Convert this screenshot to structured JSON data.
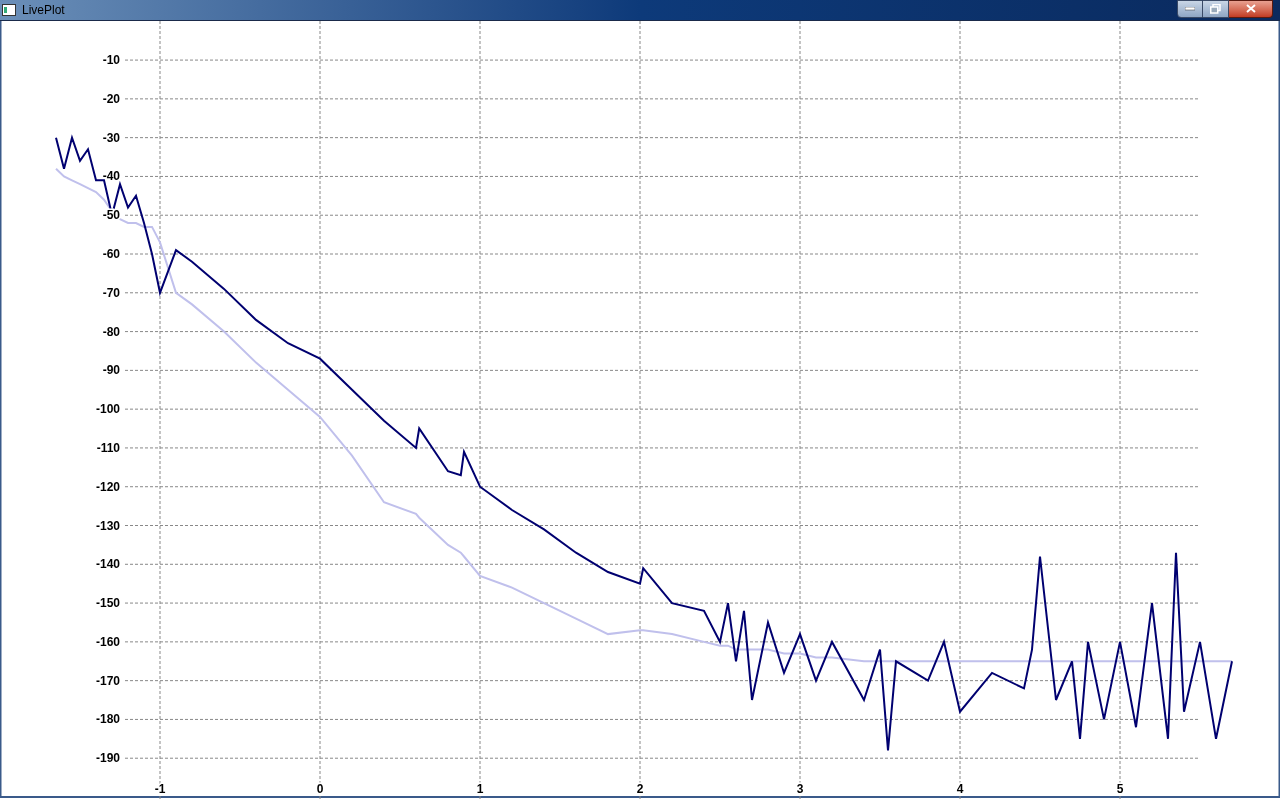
{
  "window": {
    "title": "LivePlot"
  },
  "chart_data": {
    "type": "line",
    "grid": true,
    "xlim": [
      -2,
      6
    ],
    "ylim": [
      -200,
      0
    ],
    "xticks": [
      -1,
      0,
      1,
      2,
      3,
      4,
      5
    ],
    "yticks": [
      -10,
      -20,
      -30,
      -40,
      -50,
      -60,
      -70,
      -80,
      -90,
      -100,
      -110,
      -120,
      -130,
      -140,
      -150,
      -160,
      -170,
      -180,
      -190
    ],
    "x": [
      -1.65,
      -1.6,
      -1.55,
      -1.5,
      -1.45,
      -1.4,
      -1.35,
      -1.3,
      -1.25,
      -1.2,
      -1.15,
      -1.1,
      -1.05,
      -1.0,
      -0.9,
      -0.8,
      -0.6,
      -0.4,
      -0.2,
      0,
      0.2,
      0.4,
      0.6,
      0.62,
      0.8,
      0.88,
      0.9,
      1.0,
      1.2,
      1.4,
      1.6,
      1.8,
      2.0,
      2.02,
      2.2,
      2.4,
      2.5,
      2.55,
      2.6,
      2.65,
      2.7,
      2.8,
      2.9,
      3.0,
      3.1,
      3.2,
      3.4,
      3.5,
      3.55,
      3.6,
      3.8,
      3.9,
      4.0,
      4.2,
      4.4,
      4.45,
      4.5,
      4.6,
      4.7,
      4.75,
      4.8,
      4.9,
      5.0,
      5.1,
      5.2,
      5.3,
      5.35,
      5.4,
      5.5,
      5.6,
      5.7
    ],
    "series": [
      {
        "color": "#c0c0ec",
        "values": [
          -38,
          -40,
          -41,
          -42,
          -43,
          -44,
          -46,
          -49,
          -51,
          -52,
          -52,
          -53,
          -53,
          -57,
          -70,
          -73,
          -80,
          -88,
          -95,
          -102,
          -112,
          -124,
          -127,
          -128,
          -135,
          -137,
          -138,
          -143,
          -146,
          -150,
          -154,
          -158,
          -157,
          -157,
          -158,
          -160,
          -161,
          -161,
          -162,
          -162,
          -162,
          -162,
          -163,
          -163,
          -164,
          -164,
          -165,
          -165,
          -165,
          -165,
          -165,
          -165,
          -165,
          -165,
          -165,
          -165,
          -165,
          -165,
          -165,
          -165,
          -165,
          -165,
          -165,
          -165,
          -165,
          -165,
          -165,
          -165,
          -165,
          -165,
          -165
        ]
      },
      {
        "color": "#000070",
        "values": [
          -30,
          -38,
          -30,
          -36,
          -33,
          -41,
          -41,
          -50,
          -42,
          -48,
          -45,
          -52,
          -60,
          -70,
          -59,
          -62,
          -69,
          -77,
          -83,
          -87,
          -95,
          -103,
          -110,
          -105,
          -116,
          -117,
          -111,
          -120,
          -126,
          -131,
          -137,
          -142,
          -145,
          -141,
          -150,
          -152,
          -160,
          -150,
          -165,
          -152,
          -175,
          -155,
          -168,
          -158,
          -170,
          -160,
          -175,
          -162,
          -188,
          -165,
          -170,
          -160,
          -178,
          -168,
          -172,
          -162,
          -138,
          -175,
          -165,
          -185,
          -160,
          -180,
          -160,
          -182,
          -150,
          -185,
          -137,
          -178,
          -160,
          -185,
          -165
        ]
      }
    ]
  }
}
